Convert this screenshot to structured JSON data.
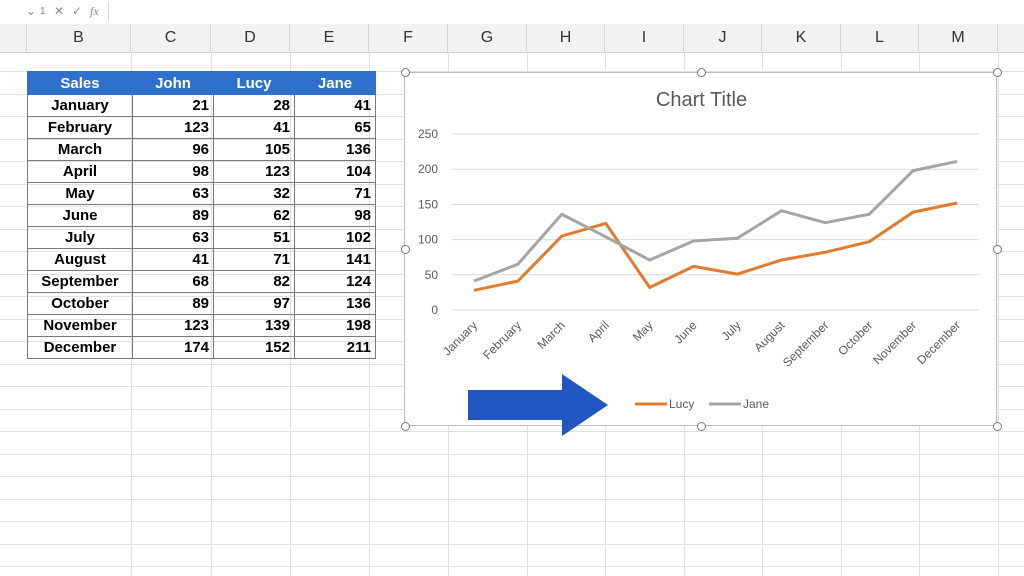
{
  "formula_bar": {
    "name_box": "1",
    "fx_icon": "fx",
    "value": ""
  },
  "columns": [
    "B",
    "C",
    "D",
    "E",
    "F",
    "G",
    "H",
    "I",
    "J",
    "K",
    "L",
    "M"
  ],
  "table": {
    "headers": [
      "Sales",
      "John",
      "Lucy",
      "Jane"
    ],
    "rows": [
      [
        "January",
        "21",
        "28",
        "41"
      ],
      [
        "February",
        "123",
        "41",
        "65"
      ],
      [
        "March",
        "96",
        "105",
        "136"
      ],
      [
        "April",
        "98",
        "123",
        "104"
      ],
      [
        "May",
        "63",
        "32",
        "71"
      ],
      [
        "June",
        "89",
        "62",
        "98"
      ],
      [
        "July",
        "63",
        "51",
        "102"
      ],
      [
        "August",
        "41",
        "71",
        "141"
      ],
      [
        "September",
        "68",
        "82",
        "124"
      ],
      [
        "October",
        "89",
        "97",
        "136"
      ],
      [
        "November",
        "123",
        "139",
        "198"
      ],
      [
        "December",
        "174",
        "152",
        "211"
      ]
    ]
  },
  "chart_data": {
    "type": "line",
    "title": "Chart Title",
    "categories": [
      "January",
      "February",
      "March",
      "April",
      "May",
      "June",
      "July",
      "August",
      "September",
      "October",
      "November",
      "December"
    ],
    "series": [
      {
        "name": "Lucy",
        "color": "#e07b2f",
        "values": [
          28,
          41,
          105,
          123,
          32,
          62,
          51,
          71,
          82,
          97,
          139,
          152
        ]
      },
      {
        "name": "Jane",
        "color": "#a5a5a5",
        "values": [
          41,
          65,
          136,
          104,
          71,
          98,
          102,
          141,
          124,
          136,
          198,
          211
        ]
      }
    ],
    "ylim": [
      0,
      250
    ],
    "yticks": [
      0,
      50,
      100,
      150,
      200,
      250
    ],
    "grid": true,
    "legend_position": "bottom"
  },
  "arrow": {
    "icon": "right-arrow-icon",
    "color": "#1f56c2"
  },
  "colors": {
    "header_bg": "#2f6fce",
    "lucy": "#e07b2f",
    "jane": "#a5a5a5"
  }
}
